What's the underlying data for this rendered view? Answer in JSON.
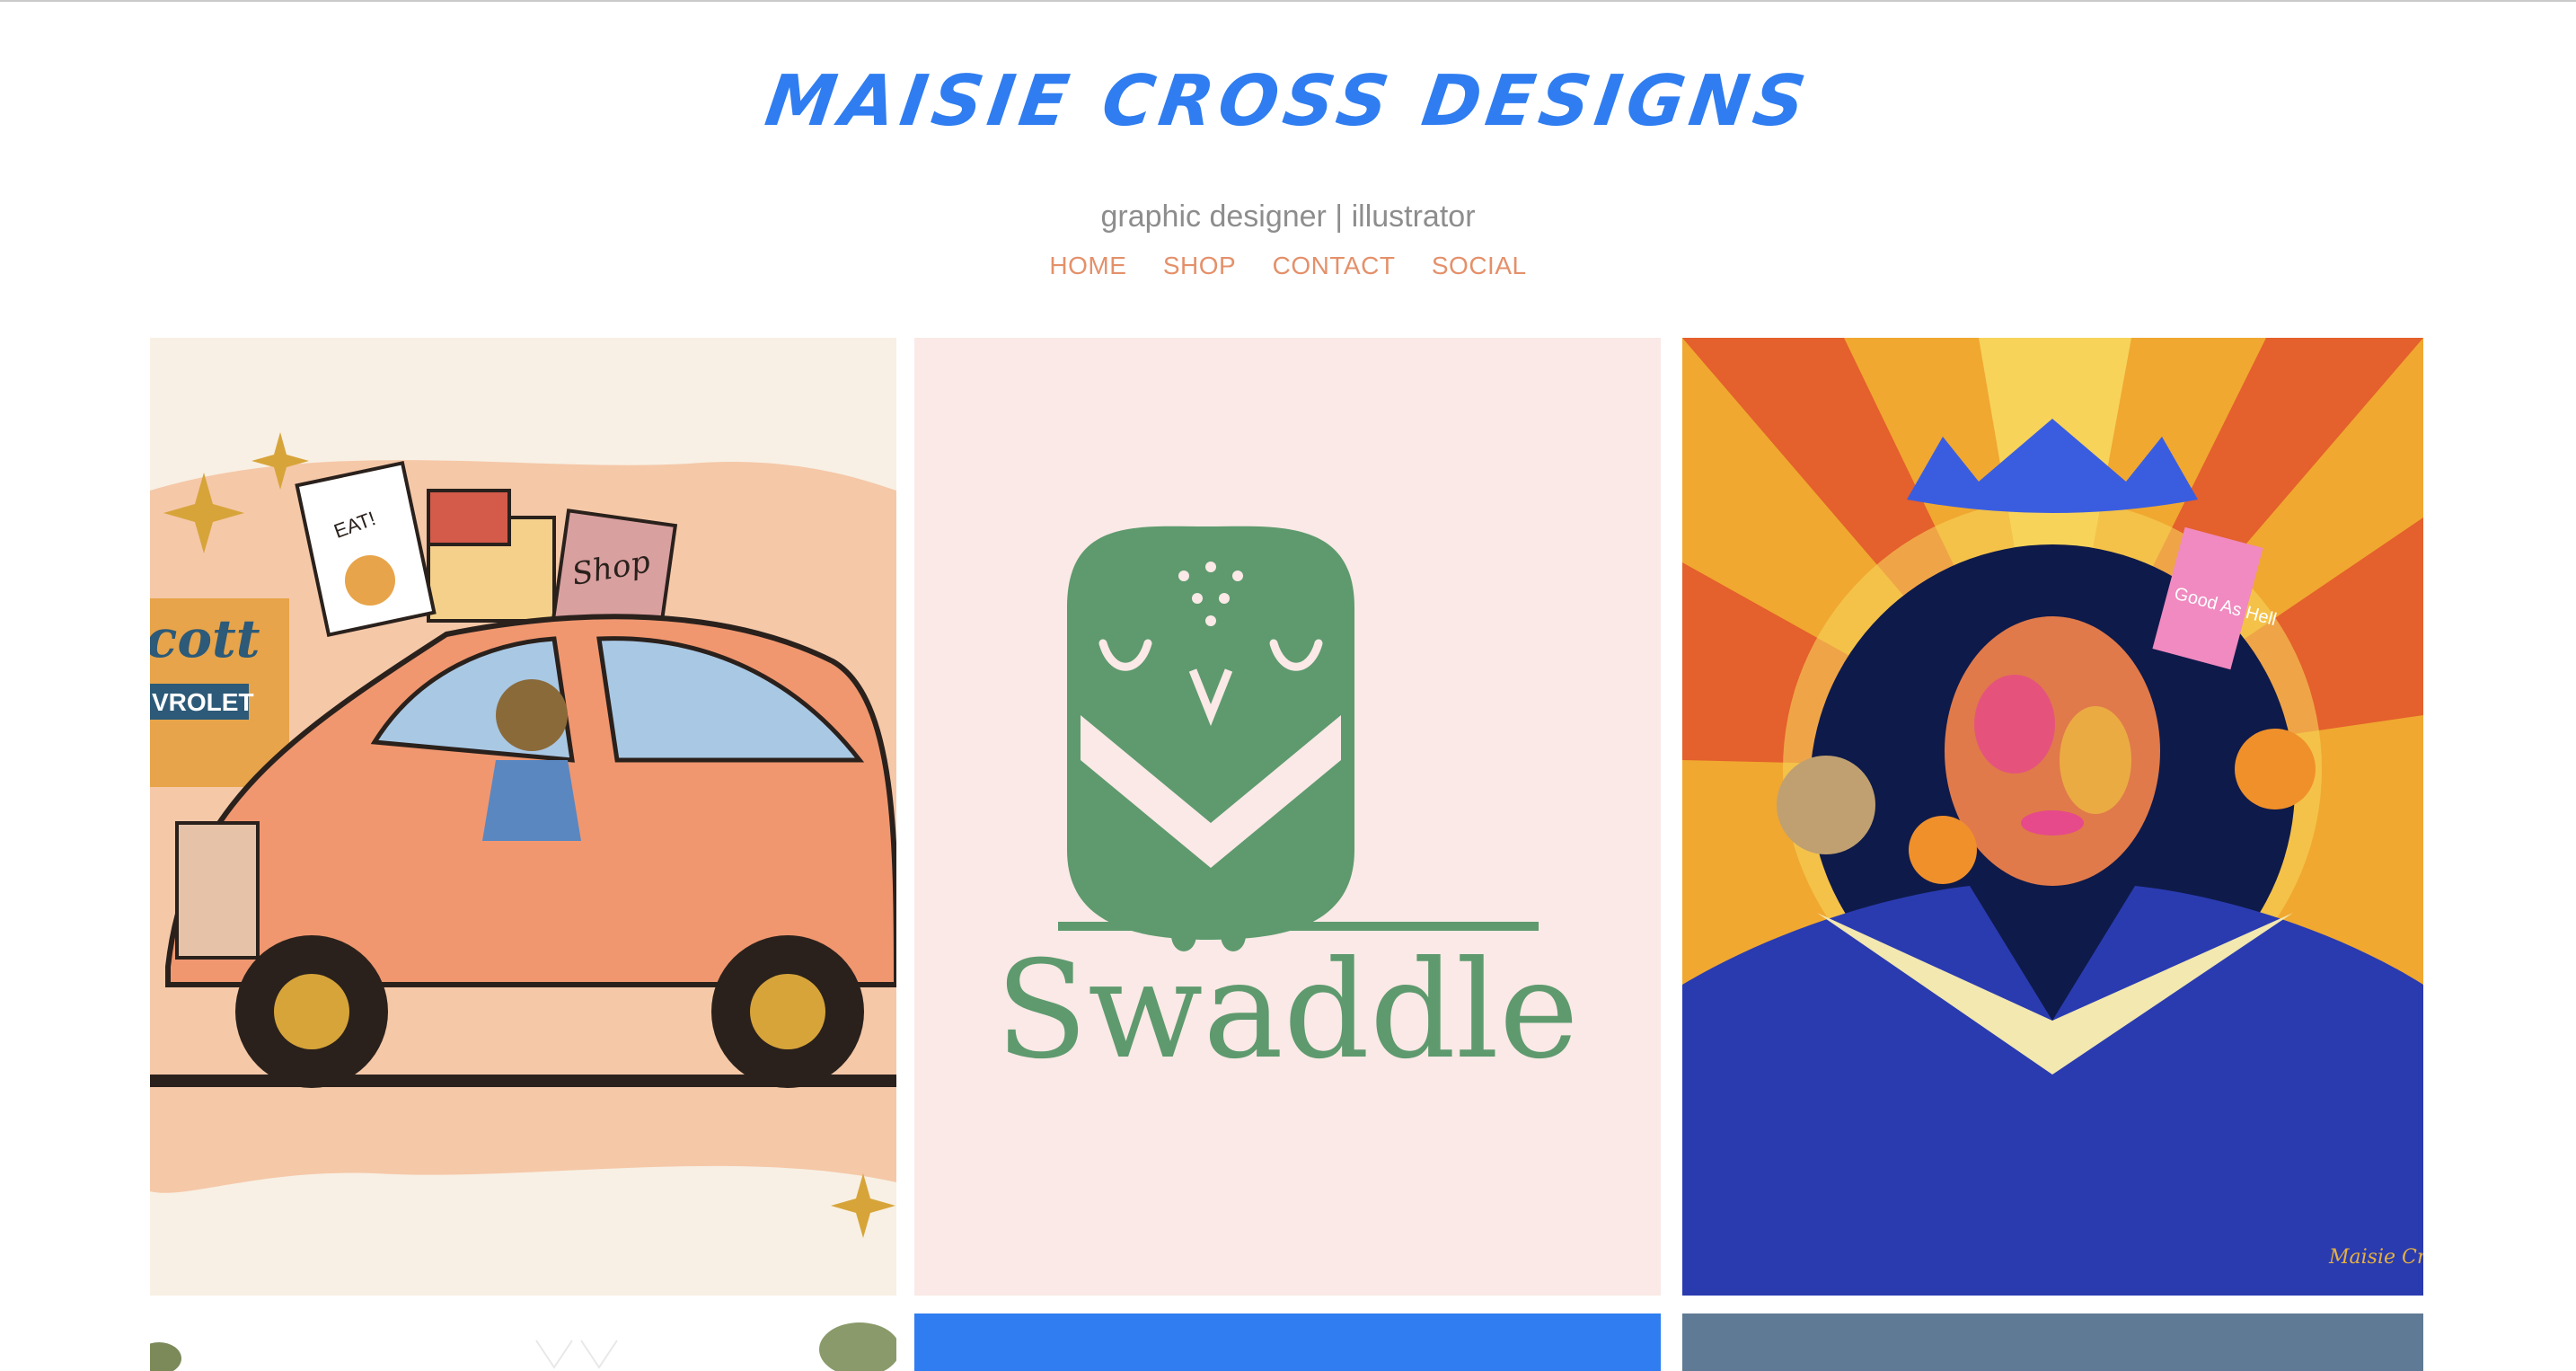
{
  "site": {
    "title": "MAISIE CROSS DESIGNS",
    "tagline": "graphic designer | illustrator"
  },
  "nav": {
    "items": [
      {
        "label": "HOME"
      },
      {
        "label": "SHOP"
      },
      {
        "label": "CONTACT"
      },
      {
        "label": "SOCIAL"
      }
    ]
  },
  "gallery": {
    "car_illustration": {
      "sign_text": "cott",
      "sign_sub": "VROLET",
      "bag1": "EAT!",
      "bag2": "Shop"
    },
    "swaddle_logo": {
      "wordmark": "Swaddle"
    },
    "portrait_illustration": {
      "signature": "Maisie Cross",
      "juice_label": "Good As Hell"
    }
  },
  "colors": {
    "brand_blue": "#2f7df0",
    "nav_orange": "#e4906a",
    "tagline_gray": "#8d8d8d",
    "swaddle_green": "#5e9a6e",
    "swaddle_bg": "#fae9e6"
  }
}
